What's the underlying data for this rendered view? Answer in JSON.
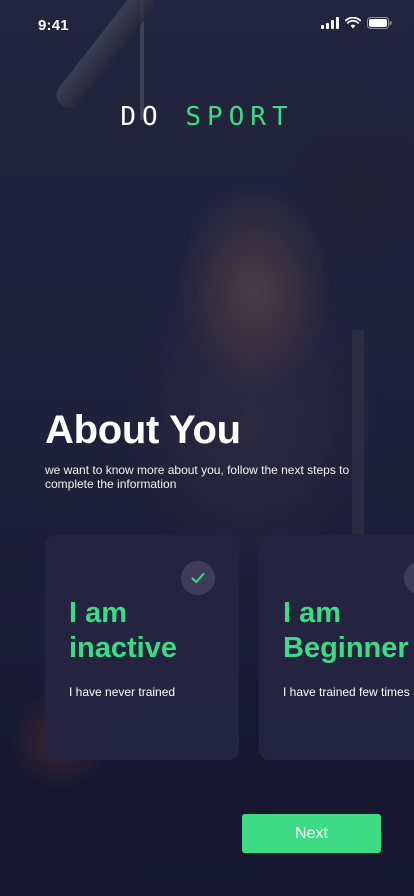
{
  "status_bar": {
    "time": "9:41",
    "icons": [
      "signal-icon",
      "wifi-icon",
      "battery-icon"
    ]
  },
  "logo": {
    "part1": "DO",
    "part2": "SPORT",
    "accent_color": "#3ddc84"
  },
  "heading": {
    "title": "About You",
    "subtitle": "we want to know more about you, follow the next steps to complete the information"
  },
  "options": [
    {
      "title_line1": "I am",
      "title_line2": "inactive",
      "description": "I have never trained",
      "selected": true,
      "icon": "check-icon"
    },
    {
      "title_line1": "I am",
      "title_line2": "Beginner",
      "description": "I have trained few times",
      "selected": false,
      "icon": "check-icon"
    }
  ],
  "actions": {
    "next_label": "Next"
  },
  "colors": {
    "accent": "#3ddc84",
    "card_background": "#252542",
    "background": "#1b1d36"
  }
}
